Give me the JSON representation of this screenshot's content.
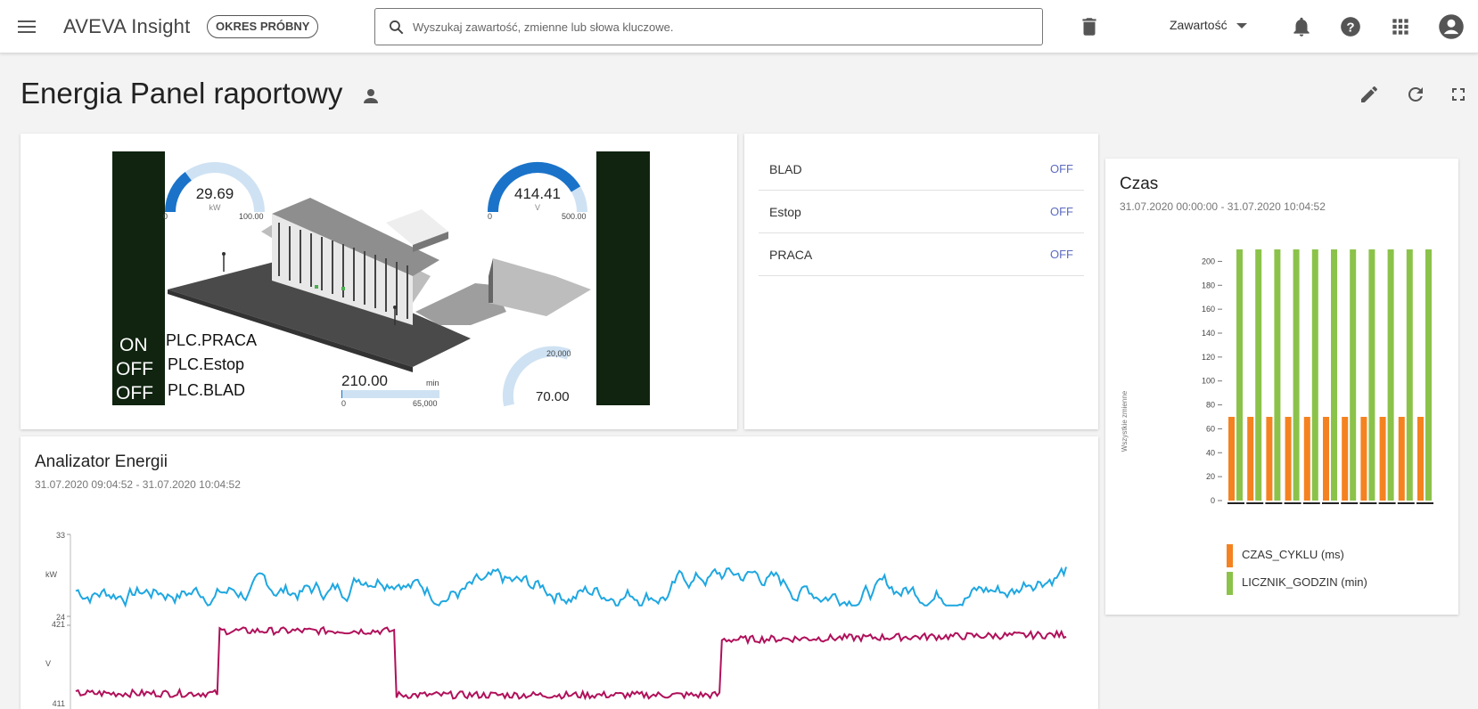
{
  "header": {
    "brand": "AVEVA Insight",
    "trial_badge": "OKRES PRÓBNY",
    "search_placeholder": "Wyszukaj zawartość, zmienne lub słowa kluczowe.",
    "content_menu": "Zawartość"
  },
  "page": {
    "title": "Energia Panel raportowy"
  },
  "graphic": {
    "gauge_power": {
      "value": "29.69",
      "unit": "kW",
      "min": "0",
      "max": "100.00",
      "fraction": 0.2969
    },
    "gauge_voltage": {
      "value": "414.41",
      "unit": "V",
      "min": "0",
      "max": "500.00",
      "fraction": 0.8288
    },
    "bar_minutes": {
      "value": "210.00",
      "unit": "min",
      "min": "0",
      "max": "65,000",
      "fraction": 0.0032
    },
    "gauge_cycle": {
      "value": "70.00",
      "max": "20,000",
      "fraction": 0.0035
    },
    "plc_states": [
      {
        "state": "ON",
        "tag": "PLC.PRACA"
      },
      {
        "state": "OFF",
        "tag": "PLC.Estop"
      },
      {
        "state": "OFF",
        "tag": "PLC.BLAD"
      }
    ]
  },
  "status_list": [
    {
      "label": "BLAD",
      "value": "OFF"
    },
    {
      "label": "Estop",
      "value": "OFF"
    },
    {
      "label": "PRACA",
      "value": "OFF"
    }
  ],
  "analyzer": {
    "title": "Analizator Energii",
    "range": "31.07.2020 09:04:52 - 31.07.2020 10:04:52",
    "chart_data": {
      "type": "line",
      "series": [
        {
          "name": "kW",
          "color": "#1ea7e1",
          "ylim": [
            24,
            33
          ]
        },
        {
          "name": "V",
          "color": "#b0105a",
          "ylim": [
            411,
            421
          ]
        }
      ],
      "kw_top": "33",
      "kw_bottom": "24",
      "kw_unit": "kW",
      "v_top": "421",
      "v_bottom": "411",
      "v_unit": "V"
    }
  },
  "czas": {
    "title": "Czas",
    "range": "31.07.2020 00:00:00 - 31.07.2020 10:04:52",
    "chart_data": {
      "type": "bar",
      "ylabel": "Wszystkie zmienne",
      "ylim": [
        0,
        210
      ],
      "yticks": [
        "0",
        "20",
        "40",
        "60",
        "80",
        "100",
        "120",
        "140",
        "160",
        "180",
        "200"
      ],
      "series": [
        {
          "name": "CZAS_CYKLU (ms)",
          "color": "#f58220",
          "values": [
            70,
            70,
            70,
            70,
            70,
            70,
            70,
            70,
            70,
            70,
            70
          ]
        },
        {
          "name": "LICZNIK_GODZIN (min)",
          "color": "#8bc34a",
          "values": [
            210,
            210,
            210,
            210,
            210,
            210,
            210,
            210,
            210,
            210,
            210
          ]
        }
      ]
    }
  }
}
